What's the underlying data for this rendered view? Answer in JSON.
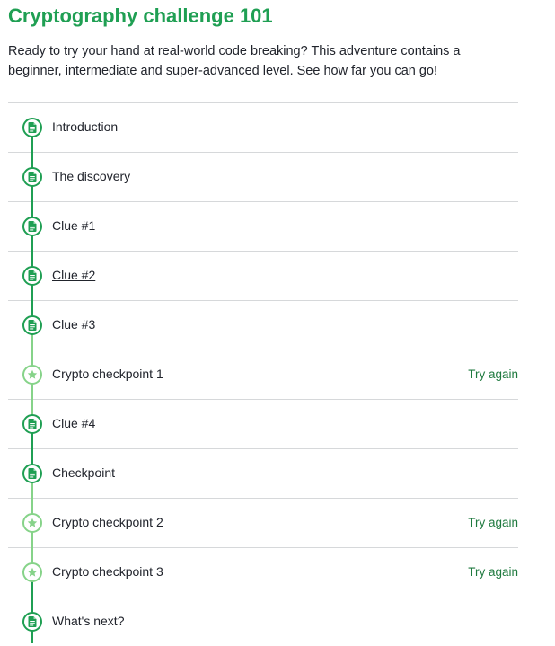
{
  "page": {
    "title": "Cryptography challenge 101",
    "description": "Ready to try your hand at real-world code breaking? This adventure contains a beginner, intermediate and super-advanced level. See how far you can go!"
  },
  "colors": {
    "accent": "#1f9f53",
    "accent_light": "#86d389",
    "status_text": "#1f7a3f",
    "divider": "#d6d8da"
  },
  "lessons": [
    {
      "label": "Introduction",
      "icon": "article-icon",
      "status": ""
    },
    {
      "label": "The discovery",
      "icon": "article-icon",
      "status": ""
    },
    {
      "label": "Clue #1",
      "icon": "article-icon",
      "status": ""
    },
    {
      "label": "Clue #2",
      "icon": "article-icon",
      "status": ""
    },
    {
      "label": "Clue #3",
      "icon": "article-icon",
      "status": ""
    },
    {
      "label": "Crypto checkpoint 1",
      "icon": "star-icon",
      "status": "Try again"
    },
    {
      "label": "Clue #4",
      "icon": "article-icon",
      "status": ""
    },
    {
      "label": "Checkpoint",
      "icon": "article-icon",
      "status": ""
    },
    {
      "label": "Crypto checkpoint 2",
      "icon": "star-icon",
      "status": "Try again"
    },
    {
      "label": "Crypto checkpoint 3",
      "icon": "star-icon",
      "status": "Try again"
    },
    {
      "label": "What's next?",
      "icon": "article-icon",
      "status": ""
    }
  ]
}
